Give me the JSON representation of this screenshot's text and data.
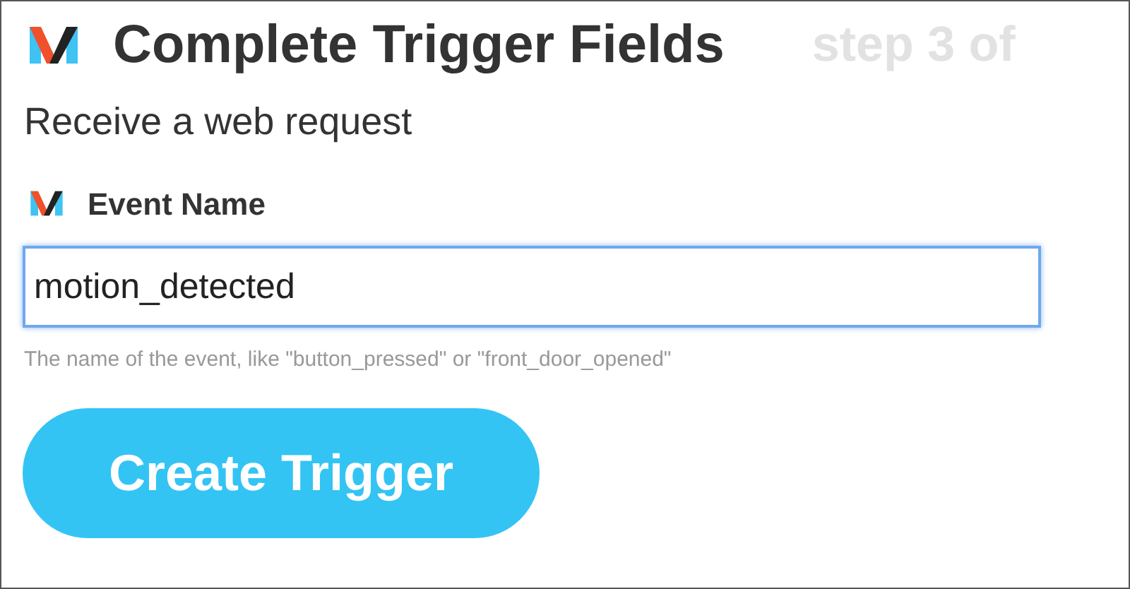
{
  "header": {
    "title": "Complete Trigger Fields",
    "step": "step 3 of"
  },
  "subtitle": "Receive a web request",
  "field": {
    "label": "Event Name",
    "value": "motion_detected",
    "focused": true,
    "hint": "The name of the event, like \"button_pressed\" or \"front_door_opened\""
  },
  "button": {
    "label": "Create Trigger"
  }
}
